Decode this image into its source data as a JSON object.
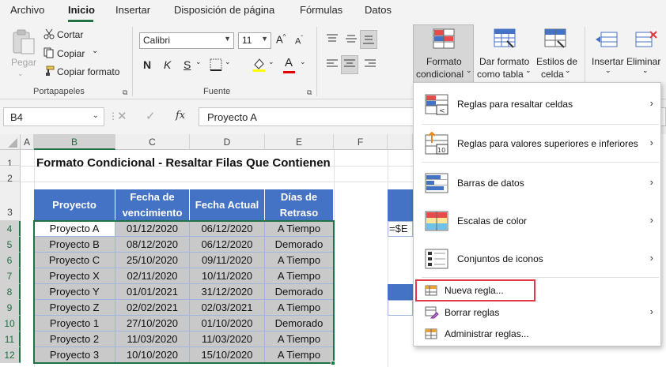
{
  "menu": {
    "tabs": [
      {
        "label": "Archivo"
      },
      {
        "label": "Inicio"
      },
      {
        "label": "Insertar"
      },
      {
        "label": "Disposición de página"
      },
      {
        "label": "Fórmulas"
      },
      {
        "label": "Datos"
      }
    ],
    "active": "Inicio"
  },
  "ribbon": {
    "clipboard": {
      "paste": "Pegar",
      "cut": "Cortar",
      "copy": "Copiar",
      "format_painter": "Copiar formato",
      "group": "Portapapeles"
    },
    "font": {
      "name": "Calibri",
      "size": "11",
      "bold": "N",
      "italic": "K",
      "underline": "S",
      "font_color_glyph": "A",
      "group": "Fuente"
    },
    "styles": {
      "conditional_l1": "Formato",
      "conditional_l2": "condicional",
      "table_l1": "Dar formato",
      "table_l2": "como tabla",
      "cell_l1": "Estilos de",
      "cell_l2": "celda"
    },
    "cells": {
      "insert": "Insertar",
      "delete": "Eliminar"
    }
  },
  "formula_bar": {
    "name_box": "B4",
    "fx": "fx",
    "value": "Proyecto A"
  },
  "sheet": {
    "columns": [
      "A",
      "B",
      "C",
      "D",
      "E",
      "F"
    ],
    "rows": [
      "1",
      "2",
      "3",
      "4",
      "5",
      "6",
      "7",
      "8",
      "9",
      "10",
      "11",
      "12"
    ],
    "title": "Formato Condicional - Resaltar Filas Que Contienen",
    "headers": [
      "Proyecto",
      "Fecha de vencimiento",
      "Fecha Actual",
      "Días de Retraso"
    ],
    "data": [
      [
        "Proyecto A",
        "01/12/2020",
        "06/12/2020",
        "A Tiempo"
      ],
      [
        "Proyecto B",
        "08/12/2020",
        "06/12/2020",
        "Demorado"
      ],
      [
        "Proyecto C",
        "25/10/2020",
        "09/11/2020",
        "A Tiempo"
      ],
      [
        "Proyecto X",
        "02/11/2020",
        "10/11/2020",
        "A Tiempo"
      ],
      [
        "Proyecto Y",
        "01/01/2021",
        "31/12/2020",
        "Demorado"
      ],
      [
        "Proyecto Z",
        "02/02/2021",
        "02/03/2021",
        "A Tiempo"
      ],
      [
        "Proyecto 1",
        "27/10/2020",
        "01/10/2020",
        "Demorado"
      ],
      [
        "Proyecto 2",
        "11/03/2020",
        "11/03/2020",
        "A Tiempo"
      ],
      [
        "Proyecto 3",
        "10/10/2020",
        "15/10/2020",
        "A Tiempo"
      ]
    ],
    "partial_formula": "=$E"
  },
  "dropdown": {
    "items": [
      {
        "label": "Reglas para resaltar celdas",
        "submenu": true
      },
      {
        "label": "Reglas para valores superiores e inferiores",
        "submenu": true
      },
      {
        "label": "Barras de datos",
        "submenu": true
      },
      {
        "label": "Escalas de color",
        "submenu": true
      },
      {
        "label": "Conjuntos de iconos",
        "submenu": true
      },
      {
        "label": "Nueva regla...",
        "submenu": false
      },
      {
        "label": "Borrar reglas",
        "submenu": true
      },
      {
        "label": "Administrar reglas...",
        "submenu": false
      }
    ]
  },
  "colors": {
    "accent": "#217346",
    "header_fill": "#4472c4",
    "row_fill": "#c9c9c9",
    "highlight": "#e0394a"
  }
}
